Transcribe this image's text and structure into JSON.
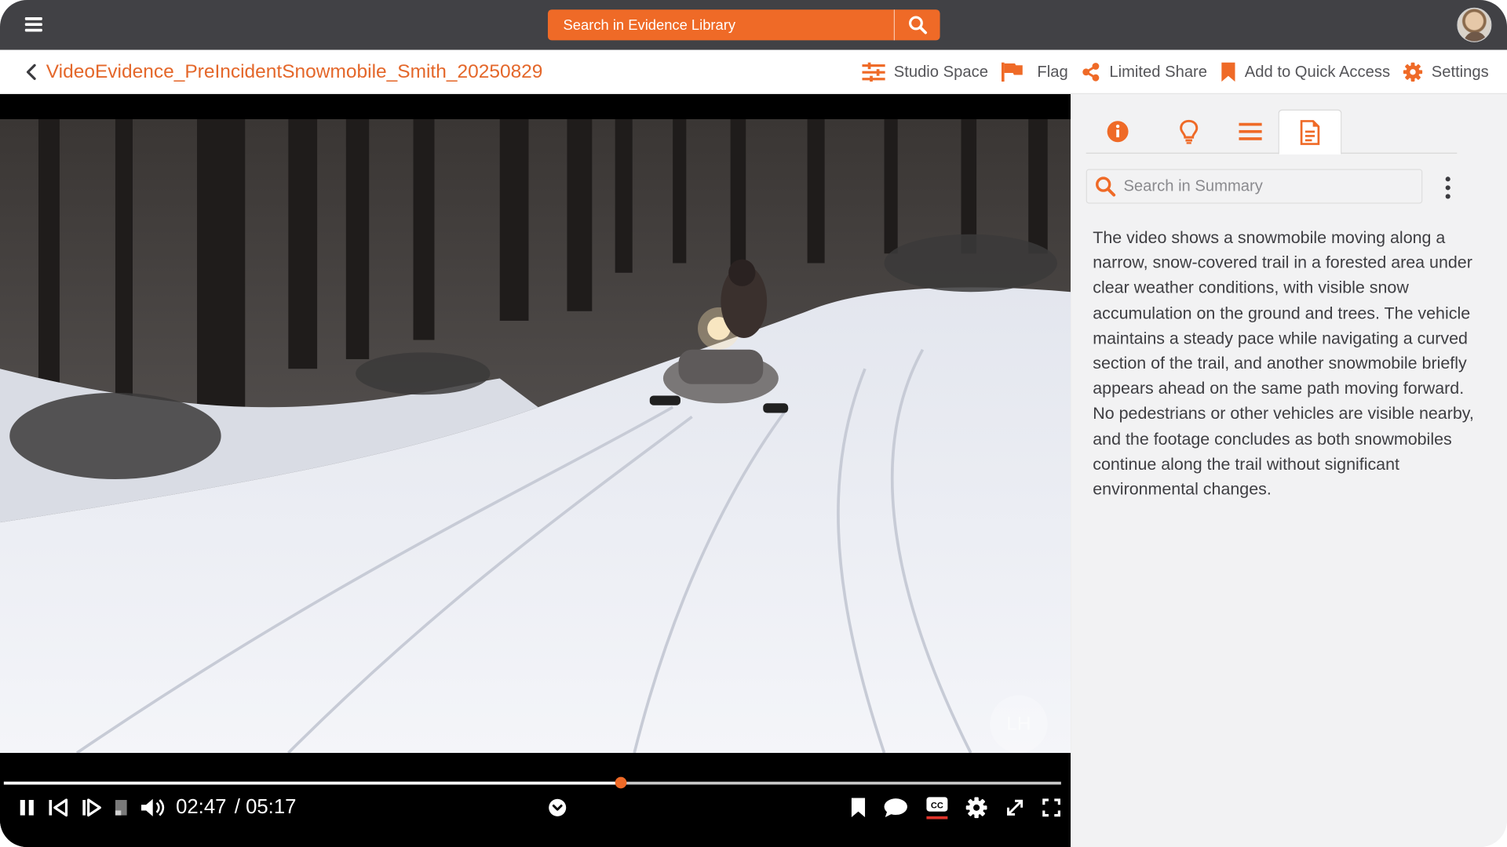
{
  "topbar": {
    "search_placeholder": "Search in Evidence Library"
  },
  "titlebar": {
    "title": "VideoEvidence_PreIncidentSnowmobile_Smith_20250829",
    "actions": [
      {
        "label": "Studio Space",
        "icon": "sliders-icon"
      },
      {
        "label": "Flag",
        "icon": "flag-icon"
      },
      {
        "label": "Limited Share",
        "icon": "share-icon"
      },
      {
        "label": "Add to Quick Access",
        "icon": "bookmark-icon"
      },
      {
        "label": "Settings",
        "icon": "gear-icon"
      }
    ]
  },
  "player": {
    "current_time": "02:47",
    "total_time": "/ 05:17",
    "progress_fraction": 0.5836,
    "watermark_text": "LH"
  },
  "panel": {
    "tabs": [
      {
        "icon": "info-icon",
        "active": false
      },
      {
        "icon": "lightbulb-icon",
        "active": false
      },
      {
        "icon": "list-icon",
        "active": false
      },
      {
        "icon": "document-icon",
        "active": true
      }
    ],
    "search_placeholder": "Search in Summary",
    "summary": "The video shows a snowmobile moving along a narrow, snow-covered trail in a forested area under clear weather conditions, with visible snow accumulation on the ground and trees. The vehicle maintains a steady pace while navigating a curved section of the trail, and another snowmobile briefly appears ahead on the same path moving forward. No pedestrians or other vehicles are visible nearby, and the footage concludes as both snowmobiles continue along the trail without significant environmental changes."
  },
  "colors": {
    "accent": "#ef6a27",
    "title_orange": "#e4672a",
    "topbar": "#414145",
    "panel_bg": "#f2f2f3"
  }
}
